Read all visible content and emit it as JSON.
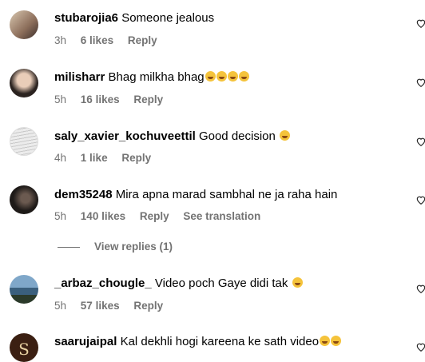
{
  "comments": [
    {
      "username": "stubarojia6",
      "text": "Someone jealous",
      "emoji_count": 0,
      "time": "3h",
      "likes": "6 likes",
      "reply": "Reply",
      "extra": ""
    },
    {
      "username": "milisharr",
      "text": "Bhag milkha bhag",
      "emoji_count": 4,
      "time": "5h",
      "likes": "16 likes",
      "reply": "Reply",
      "extra": ""
    },
    {
      "username": "saly_xavier_kochuveettil",
      "text": "Good decision",
      "emoji_count": 1,
      "time": "4h",
      "likes": "1 like",
      "reply": "Reply",
      "extra": ""
    },
    {
      "username": "dem35248",
      "text": "Mira apna marad sambhal ne ja raha hain",
      "emoji_count": 0,
      "time": "5h",
      "likes": "140 likes",
      "reply": "Reply",
      "extra": "See translation"
    },
    {
      "username": "_arbaz_chougle_",
      "text": "Video poch Gaye didi tak",
      "emoji_count": 1,
      "time": "5h",
      "likes": "57 likes",
      "reply": "Reply",
      "extra": ""
    },
    {
      "username": "saarujaipal",
      "text": "Kal dekhli hogi kareena ke sath video",
      "emoji_count": 2,
      "time": "",
      "likes": "",
      "reply": "",
      "extra": ""
    }
  ],
  "view_replies": "View replies (1)",
  "colors": {
    "meta": "#737373",
    "emoji": "#f5c33b"
  }
}
